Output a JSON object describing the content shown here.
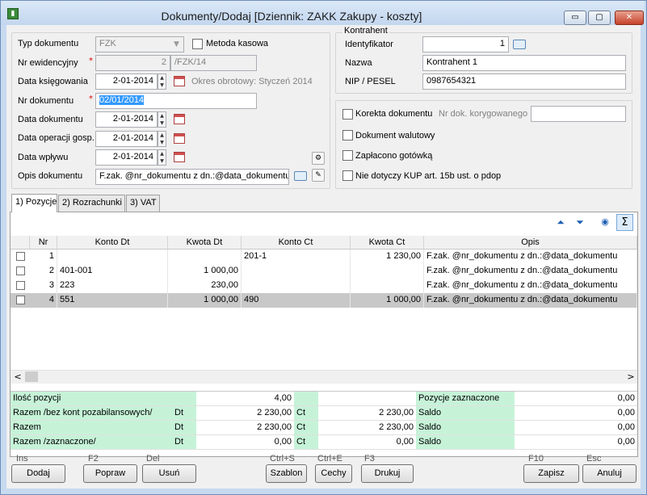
{
  "window": {
    "title": "Dokumenty/Dodaj [Dziennik: ZAKK  Zakupy - koszty]",
    "min_glyph": "▭",
    "max_glyph": "▢",
    "close_glyph": "✕"
  },
  "form": {
    "typ_label": "Typ dokumentu",
    "typ_value": "FZK",
    "metoda_kasowa_label": "Metoda kasowa",
    "nr_ewid_label": "Nr ewidencyjny",
    "nr_ewid_num": "2",
    "nr_ewid_suffix": "/FZK/14",
    "data_ksieg_label": "Data księgowania",
    "data_ksieg_value": "2-01-2014",
    "okres_label": "Okres obrotowy: Styczeń 2014",
    "nr_dok_label": "Nr dokumentu",
    "nr_dok_value": "02/01/2014",
    "data_dok_label": "Data dokumentu",
    "data_dok_value": "2-01-2014",
    "data_oper_label": "Data operacji gosp.",
    "data_oper_value": "2-01-2014",
    "data_wplywu_label": "Data wpływu",
    "data_wplywu_value": "2-01-2014",
    "opis_label": "Opis dokumentu",
    "opis_value": "F.zak. @nr_dokumentu z dn.:@data_dokumentu",
    "required_mark": "*"
  },
  "kontrahent": {
    "group_label": "Kontrahent",
    "id_label": "Identyfikator",
    "id_value": "1",
    "nazwa_label": "Nazwa",
    "nazwa_value": "Kontrahent 1",
    "nip_label": "NIP / PESEL",
    "nip_value": "0987654321"
  },
  "options": {
    "korekta_label": "Korekta dokumentu",
    "nr_korygowanego_label": "Nr dok. korygowanego",
    "walutowy_label": "Dokument walutowy",
    "gotowka_label": "Zapłacono gotówką",
    "kup_label": "Nie dotyczy KUP art. 15b ust. o pdop"
  },
  "tabs": [
    {
      "label": "1) Pozycje"
    },
    {
      "label": "2) Rozrachunki"
    },
    {
      "label": "3) VAT"
    }
  ],
  "toolbar": {
    "up_glyph": "⏶",
    "down_glyph": "⏷",
    "preview_glyph": "◉",
    "sum_glyph": "Σ"
  },
  "grid": {
    "headers": [
      "Nr",
      "Konto Dt",
      "Kwota Dt",
      "Konto Ct",
      "Kwota Ct",
      "Opis"
    ],
    "rows": [
      {
        "nr": "1",
        "konto_dt": "",
        "kwota_dt": "",
        "konto_ct": "201-1",
        "kwota_ct": "1 230,00",
        "opis": "F.zak. @nr_dokumentu z dn.:@data_dokumentu"
      },
      {
        "nr": "2",
        "konto_dt": "401-001",
        "kwota_dt": "1 000,00",
        "konto_ct": "",
        "kwota_ct": "",
        "opis": "F.zak. @nr_dokumentu z dn.:@data_dokumentu"
      },
      {
        "nr": "3",
        "konto_dt": "223",
        "kwota_dt": "230,00",
        "konto_ct": "",
        "kwota_ct": "",
        "opis": "F.zak. @nr_dokumentu z dn.:@data_dokumentu"
      },
      {
        "nr": "4",
        "konto_dt": "551",
        "kwota_dt": "1 000,00",
        "konto_ct": "490",
        "kwota_ct": "1 000,00",
        "opis": "F.zak. @nr_dokumentu z dn.:@data_dokumentu"
      }
    ],
    "selected_row": 4,
    "scroll_left_glyph": "<",
    "scroll_right_glyph": ">"
  },
  "summary": {
    "rows": [
      {
        "label": "Ilość pozycji",
        "dt_label": "",
        "dt_value": "4,00",
        "ct_label": "",
        "ct_value": "",
        "right_label": "Pozycje zaznaczone",
        "right_value": "0,00"
      },
      {
        "label": "Razem /bez kont pozabilansowych/",
        "dt_label": "Dt",
        "dt_value": "2 230,00",
        "ct_label": "Ct",
        "ct_value": "2 230,00",
        "right_label": "Saldo",
        "right_value": "0,00"
      },
      {
        "label": "Razem",
        "dt_label": "Dt",
        "dt_value": "2 230,00",
        "ct_label": "Ct",
        "ct_value": "2 230,00",
        "right_label": "Saldo",
        "right_value": "0,00"
      },
      {
        "label": "Razem /zaznaczone/",
        "dt_label": "Dt",
        "dt_value": "0,00",
        "ct_label": "Ct",
        "ct_value": "0,00",
        "right_label": "Saldo",
        "right_value": "0,00"
      }
    ]
  },
  "buttons": {
    "dodaj": {
      "label": "Dodaj",
      "key": "Ins"
    },
    "popraw": {
      "label": "Popraw",
      "key": "F2"
    },
    "usun": {
      "label": "Usuń",
      "key": "Del"
    },
    "szablon": {
      "label": "Szablon",
      "key": "Ctrl+S"
    },
    "cechy": {
      "label": "Cechy",
      "key": "Ctrl+E"
    },
    "drukuj": {
      "label": "Drukuj",
      "key": "F3"
    },
    "zapisz": {
      "label": "Zapisz",
      "key": "F10"
    },
    "anuluj": {
      "label": "Anuluj",
      "key": "Esc"
    }
  }
}
